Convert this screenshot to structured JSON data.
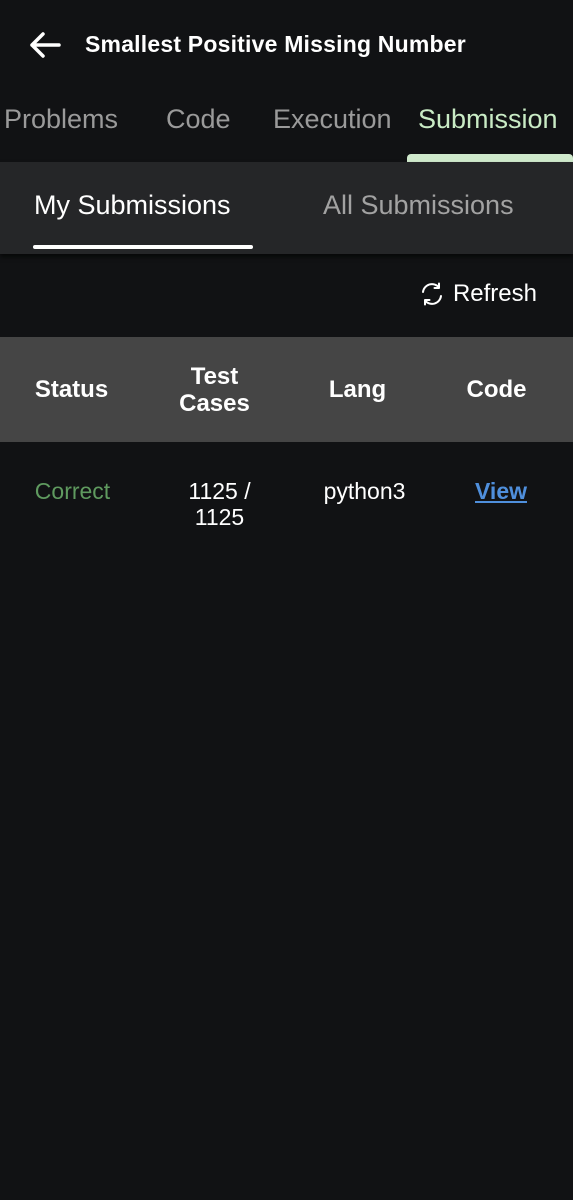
{
  "header": {
    "title": "Smallest Positive Missing Number"
  },
  "top_tabs": [
    {
      "label": "Problems",
      "active": false
    },
    {
      "label": "Code",
      "active": false
    },
    {
      "label": "Execution",
      "active": false
    },
    {
      "label": "Submission",
      "active": true
    }
  ],
  "sub_tabs": [
    {
      "label": "My Submissions",
      "active": true
    },
    {
      "label": "All Submissions",
      "active": false
    }
  ],
  "refresh": {
    "label": "Refresh"
  },
  "table": {
    "headers": [
      "Status",
      "Test\nCases",
      "Lang",
      "Code"
    ],
    "rows": [
      {
        "status": "Correct",
        "test_cases": "1125 /\n1125",
        "lang": "python3",
        "code": "View"
      }
    ]
  },
  "colors": {
    "background": "#111214",
    "active_tab": "#c9ebc5",
    "status_correct": "#5f9a5f",
    "link": "#4f8fdc",
    "table_header": "#454545"
  },
  "icons": {
    "back": "arrow-left-icon",
    "refresh": "refresh-icon"
  }
}
